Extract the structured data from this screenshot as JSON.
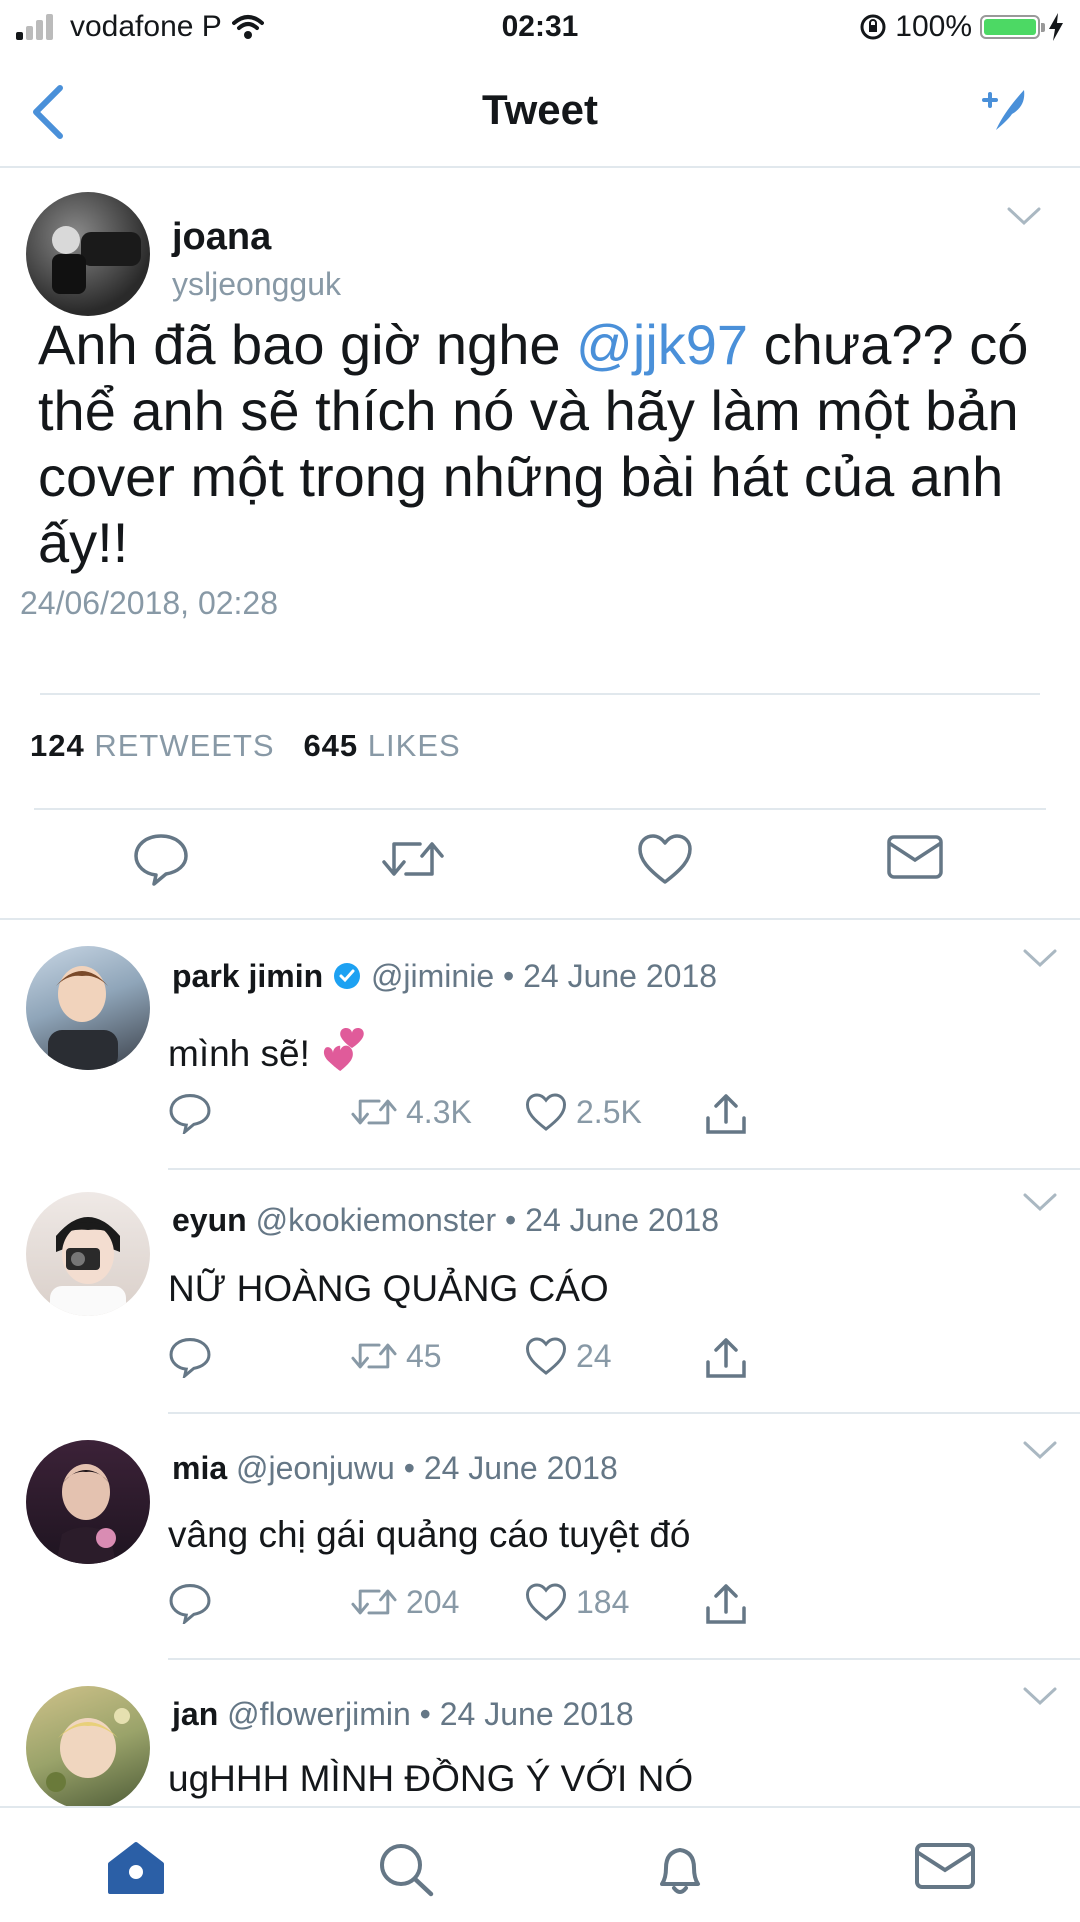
{
  "status_bar": {
    "carrier": "vodafone P",
    "time": "02:31",
    "battery": "100%",
    "battery_level": 1.0
  },
  "header": {
    "title": "Tweet",
    "back_icon": "chevron-left-icon",
    "compose_icon": "compose-tweet-icon"
  },
  "tweet": {
    "author_name": "joana",
    "author_handle": "ysljeongguk",
    "text_before": "Anh đã bao giờ nghe ",
    "mention": "@jjk97",
    "text_after": " chưa?? có thể anh sẽ thích nó và hãy làm một bản cover một trong những bài hát của anh ấy!!",
    "date": "24/06/2018, 02:28",
    "retweets_count": "124",
    "retweets_label": "RETWEETS",
    "likes_count": "645",
    "likes_label": "LIKES"
  },
  "replies": [
    {
      "name": "park jimin",
      "verified": true,
      "meta": "@jiminie • 24 June 2018",
      "text": "mình sẽ!",
      "emoji": "two-hearts",
      "retweets": "4.3K",
      "likes": "2.5K"
    },
    {
      "name": "eyun",
      "verified": false,
      "meta": "@kookiemonster • 24 June 2018",
      "text": "NỮ HOÀNG QUẢNG CÁO",
      "retweets": "45",
      "likes": "24"
    },
    {
      "name": "mia",
      "verified": false,
      "meta": "@jeonjuwu • 24 June 2018",
      "text": "vâng chị gái quảng cáo tuyệt đó",
      "retweets": "204",
      "likes": "184"
    },
    {
      "name": "jan",
      "verified": false,
      "meta": "@flowerjimin • 24 June 2018",
      "text": "ugHHH MÌNH ĐỒNG Ý VỚI NÓ"
    }
  ],
  "colors": {
    "accent": "#4a90d9",
    "text": "#14171a",
    "muted": "#8899a6",
    "divider": "#e1e8ed",
    "home_active": "#2b5fa6",
    "heart_emoji": "#e05b9a"
  },
  "tabbar": [
    "home-icon",
    "search-icon",
    "notifications-icon",
    "messages-icon"
  ]
}
